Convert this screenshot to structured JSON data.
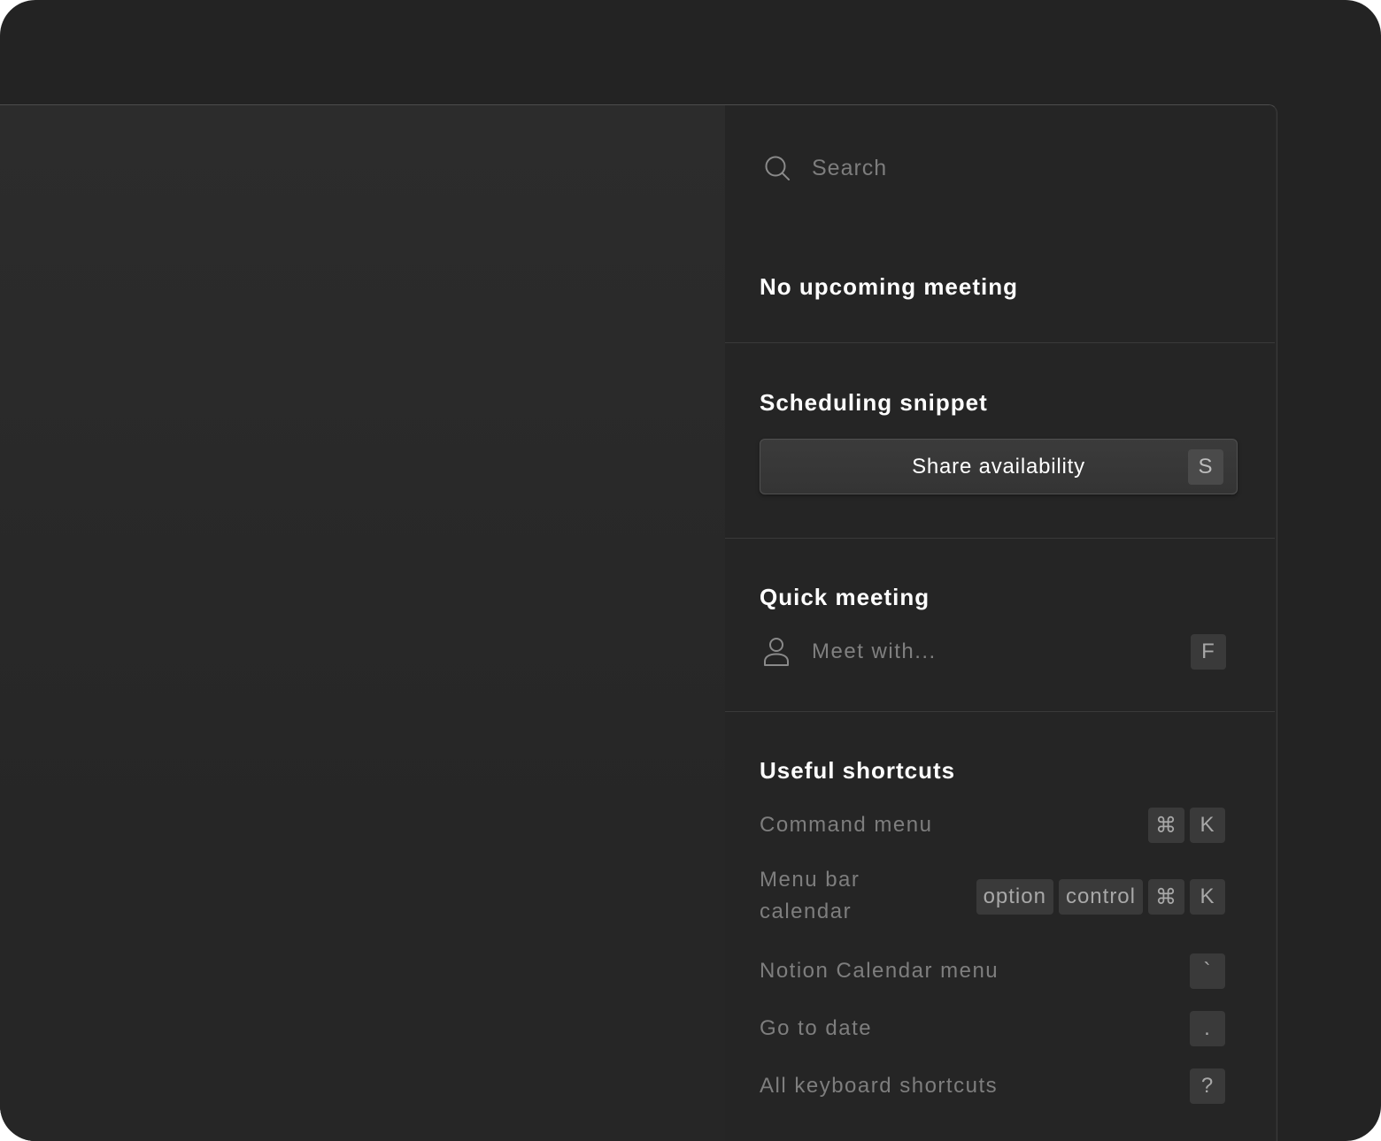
{
  "search": {
    "placeholder": "Search"
  },
  "upcoming": {
    "title": "No upcoming meeting"
  },
  "scheduling": {
    "title": "Scheduling snippet",
    "button_label": "Share availability",
    "button_key": "S"
  },
  "quick_meeting": {
    "title": "Quick meeting",
    "meet_label": "Meet with...",
    "meet_key": "F"
  },
  "shortcuts": {
    "title": "Useful shortcuts",
    "items": [
      {
        "label": "Command menu",
        "keys": [
          "⌘",
          "K"
        ]
      },
      {
        "label": "Menu bar calendar",
        "label_line1": "Menu bar",
        "label_line2": "calendar",
        "keys": [
          "option",
          "control",
          "⌘",
          "K"
        ]
      },
      {
        "label": "Notion Calendar menu",
        "keys": [
          "`"
        ]
      },
      {
        "label": "Go to date",
        "keys": [
          "."
        ]
      },
      {
        "label": "All keyboard shortcuts",
        "keys": [
          "?"
        ]
      }
    ]
  },
  "icons": {
    "search": "search-icon",
    "person": "person-icon"
  },
  "colors": {
    "background": "#232323",
    "panel": "#252525",
    "title_text": "#ffffff",
    "muted_text": "#7e7e7e",
    "key_background": "#3a3a3a"
  }
}
